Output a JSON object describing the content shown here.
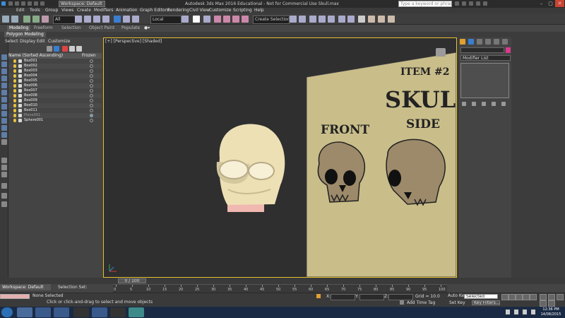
{
  "titlebar": {
    "workspace": "Workspace: Default",
    "title": "Autodesk 3ds Max 2016 Educational - Not for Commercial Use   Skull.max",
    "search_placeholder": "Type a keyword or phrase",
    "min": "–",
    "max": "▢",
    "close": "✕"
  },
  "menu": [
    "Edit",
    "Tools",
    "Group",
    "Views",
    "Create",
    "Modifiers",
    "Animation",
    "Graph Editors",
    "Rendering",
    "Civil View",
    "Customize",
    "Scripting",
    "Help"
  ],
  "toolbar": {
    "filter": "All",
    "coord": "Local",
    "selset": "Create Selection Se"
  },
  "ribbon": {
    "tabs": [
      "Modeling",
      "Freeform",
      "Selection",
      "Object Paint",
      "Populate"
    ],
    "sub_label": "Polygon Modeling"
  },
  "explorer": {
    "menu": [
      "Select",
      "Display",
      "Edit",
      "Customize"
    ],
    "col_name": "Name (Sorted Ascending)",
    "col_frozen": "Frozen",
    "rows": [
      "Box001",
      "Box002",
      "Box003",
      "Box004",
      "Box005",
      "Box006",
      "Box007",
      "Box008",
      "Box009",
      "Box010",
      "Box011",
      "Plane001",
      "Sphere001"
    ]
  },
  "viewport": {
    "label": "[+] [Perspective] [Shaded]",
    "poster": {
      "item": "ITEM #2",
      "title": "SKULL",
      "front": "FRONT",
      "side": "SIDE"
    }
  },
  "cmdpanel": {
    "modifier_list": "Modifier List"
  },
  "timeline": {
    "workspace": "Workspace: Default",
    "selection_set": "Selection Set:",
    "slider": "0 / 100",
    "ticks": [
      "0",
      "5",
      "10",
      "15",
      "20",
      "25",
      "30",
      "35",
      "40",
      "45",
      "50",
      "55",
      "60",
      "65",
      "70",
      "75",
      "80",
      "85",
      "90",
      "95",
      "100"
    ]
  },
  "status": {
    "none_selected": "None Selected",
    "hint": "Click or click-and-drag to select and move objects",
    "x_label": "X:",
    "y_label": "Y:",
    "z_label": "Z:",
    "grid": "Grid = 10.0",
    "add_time_tag": "Add Time Tag",
    "auto_key": "Auto Key",
    "key_dd": "Selected",
    "set_key": "Set Key",
    "key_filters": "Key Filters..."
  },
  "taskbar": {
    "time": "12:36 PM",
    "date": "14/08/2015"
  },
  "colors": {
    "viewport_border": "#e3c030",
    "skull": "#ede0b5",
    "poster": "#c9bd8a",
    "object_color_swatch": "#d83a8c"
  }
}
